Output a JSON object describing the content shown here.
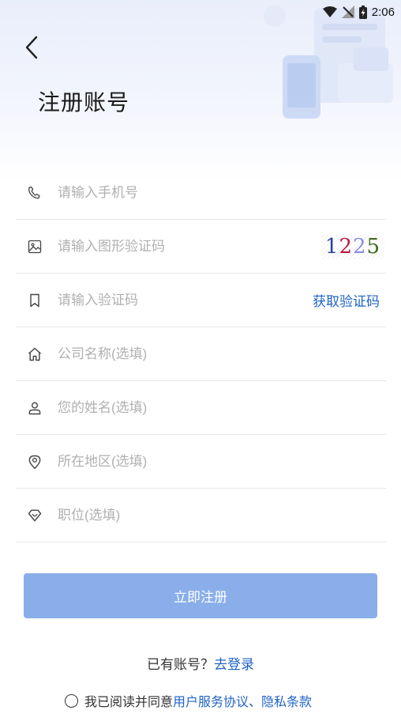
{
  "status_bar": {
    "time": "2:06"
  },
  "header": {
    "title": "注册账号"
  },
  "form": {
    "phone_placeholder": "请输入手机号",
    "captcha_placeholder": "请输入图形验证码",
    "captcha_code": [
      "1",
      "2",
      "2",
      "5"
    ],
    "sms_placeholder": "请输入验证码",
    "sms_button": "获取验证码",
    "company_placeholder": "公司名称(选填)",
    "name_placeholder": "您的姓名(选填)",
    "region_placeholder": "所在地区(选填)",
    "position_placeholder": "职位(选填)"
  },
  "submit_label": "立即注册",
  "login": {
    "prompt": "已有账号？",
    "link": "去登录"
  },
  "agreement": {
    "prefix": "我已阅读并同意",
    "service_link": "用户服务协议",
    "separator": "、",
    "privacy_link": "隐私条款"
  },
  "colors": {
    "accent": "#1f63c6",
    "button": "#89aeea",
    "placeholder": "#b0b0b0",
    "divider": "#e6e6e6"
  }
}
